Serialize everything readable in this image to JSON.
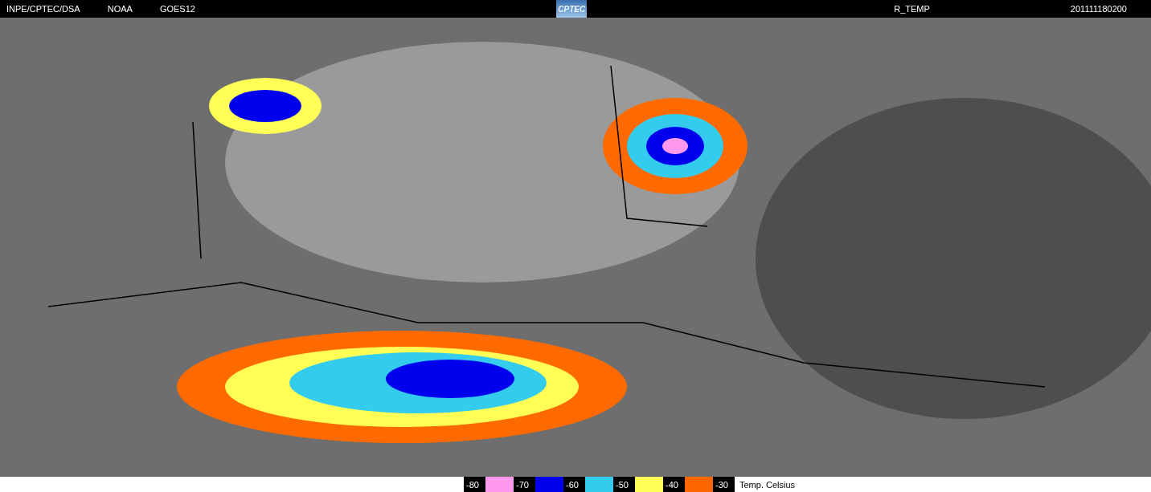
{
  "header": {
    "labels": [
      "INPE/CPTEC/DSA",
      "NOAA",
      "GOES12"
    ],
    "logo": "CPTEC",
    "product": "R_TEMP",
    "timestamp": "201111180200"
  },
  "legend": {
    "items": [
      {
        "label": "-80",
        "color": "#ff99ee"
      },
      {
        "label": "-70",
        "color": "#0000ee"
      },
      {
        "label": "-60",
        "color": "#33ccee"
      },
      {
        "label": "-50",
        "color": "#ffff55"
      },
      {
        "label": "-40",
        "color": "#ff6600"
      },
      {
        "label": "-30"
      }
    ],
    "unit": "Temp. Celsius"
  }
}
